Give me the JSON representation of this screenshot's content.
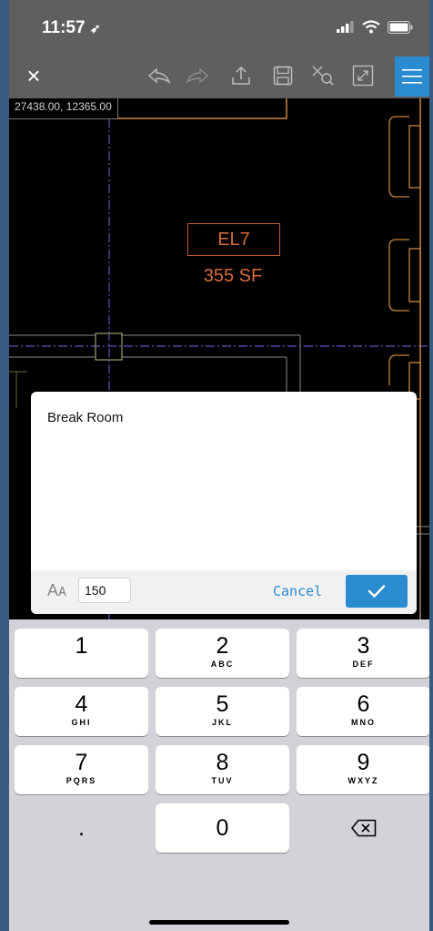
{
  "status_bar": {
    "time": "11:57",
    "location_glyph": "➶"
  },
  "toolbar": {
    "close_glyph": "×",
    "icons": [
      "undo-icon",
      "redo-icon",
      "share-icon",
      "save-icon",
      "zoom-extents-icon",
      "fullscreen-icon",
      "menu-icon"
    ]
  },
  "canvas": {
    "coordinates": "27438.00, 12365.00",
    "room_name": "EL7",
    "room_area": "355 SF"
  },
  "dialog": {
    "text": "Break Room",
    "font_size_label": "Aᴀ",
    "font_size_value": "150",
    "cancel_label": "Cancel"
  },
  "keypad": {
    "keys": [
      {
        "num": "1",
        "letters": ""
      },
      {
        "num": "2",
        "letters": "ABC"
      },
      {
        "num": "3",
        "letters": "DEF"
      },
      {
        "num": "4",
        "letters": "GHI"
      },
      {
        "num": "5",
        "letters": "JKL"
      },
      {
        "num": "6",
        "letters": "MNO"
      },
      {
        "num": "7",
        "letters": "PQRS"
      },
      {
        "num": "8",
        "letters": "TUV"
      },
      {
        "num": "9",
        "letters": "WXYZ"
      },
      {
        "num": ".",
        "letters": ""
      },
      {
        "num": "0",
        "letters": ""
      }
    ]
  },
  "colors": {
    "accent": "#2a8bd0",
    "toolbar_bg": "#5f5f5f",
    "room_label": "#d46c3c"
  }
}
